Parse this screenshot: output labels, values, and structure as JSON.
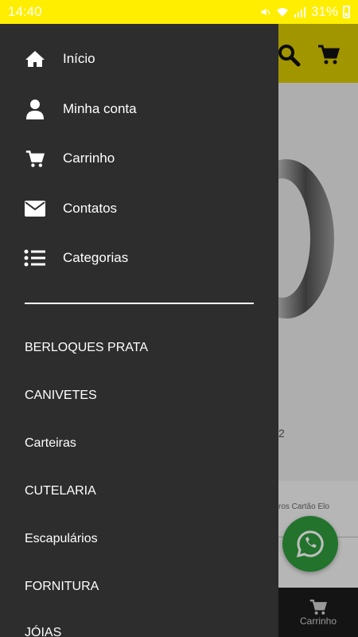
{
  "status_bar": {
    "time": "14:40",
    "battery": "31%"
  },
  "drawer": {
    "menu": [
      {
        "label": "Início",
        "icon": "home-icon"
      },
      {
        "label": "Minha conta",
        "icon": "user-icon"
      },
      {
        "label": "Carrinho",
        "icon": "cart-icon"
      },
      {
        "label": "Contatos",
        "icon": "envelope-icon"
      },
      {
        "label": "Categorias",
        "icon": "list-icon"
      }
    ],
    "categories": [
      "BERLOQUES PRATA",
      "CANIVETES",
      "Carteiras",
      "CUTELARIA",
      "Escapulários",
      "FORNITURA",
      "JÓIAS"
    ]
  },
  "background": {
    "price_fragment": "2",
    "payment_fragment": "ros Cartão Elo",
    "bottom_nav_label": "Carrinho"
  },
  "colors": {
    "accent": "#ffee00",
    "drawer": "#2d2d2d",
    "whatsapp": "#2f9a3c"
  }
}
